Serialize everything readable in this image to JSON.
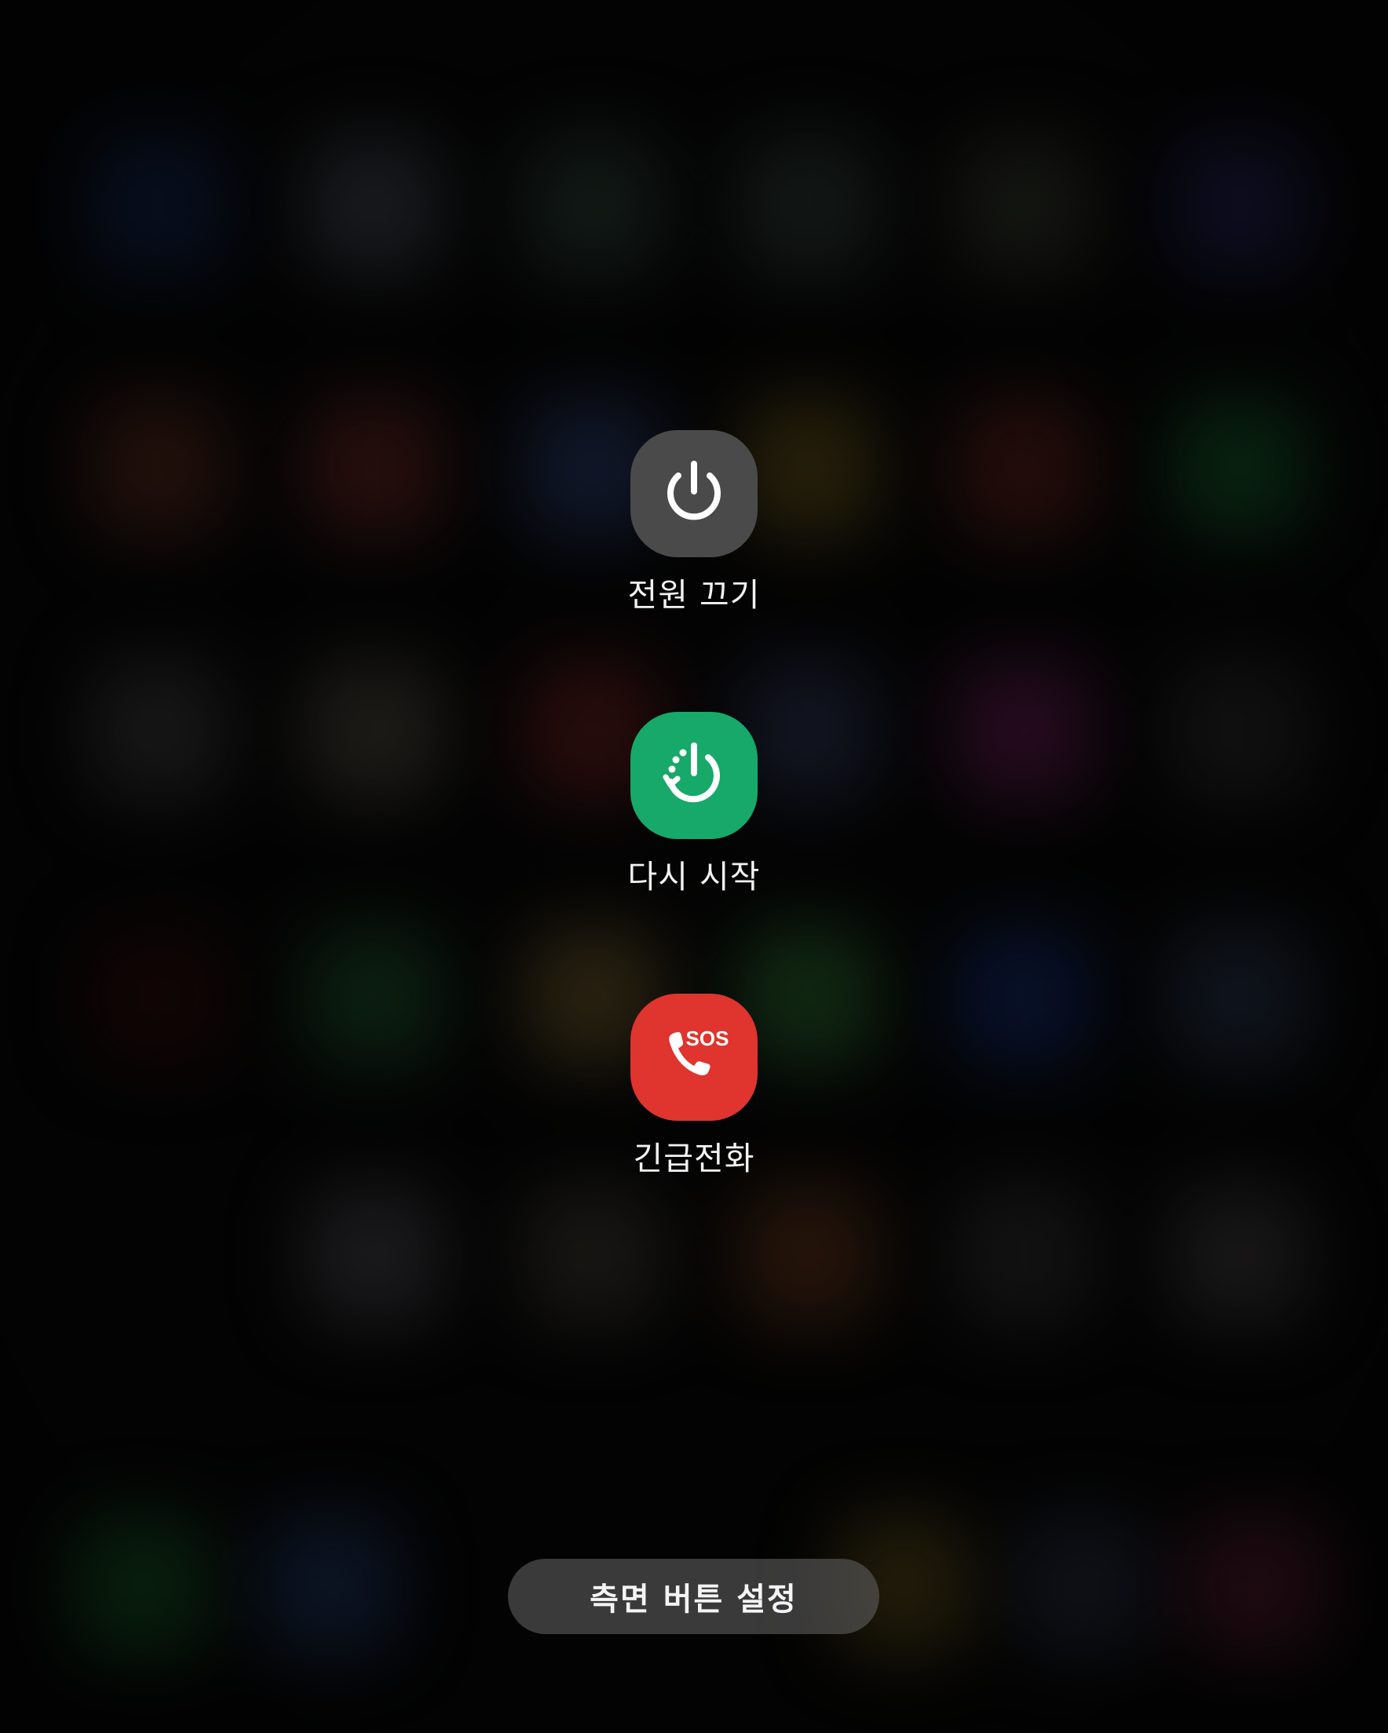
{
  "power_menu": {
    "actions": [
      {
        "label": "전원 끄기",
        "icon": "power-icon",
        "color": "#4a4a4a"
      },
      {
        "label": "다시 시작",
        "icon": "restart-icon",
        "color": "#17a96a"
      },
      {
        "label": "긴급전화",
        "icon": "sos-phone-icon",
        "color": "#e0342e",
        "badge": "SOS"
      }
    ]
  },
  "side_key_settings": {
    "label": "측면 버튼 설정"
  }
}
